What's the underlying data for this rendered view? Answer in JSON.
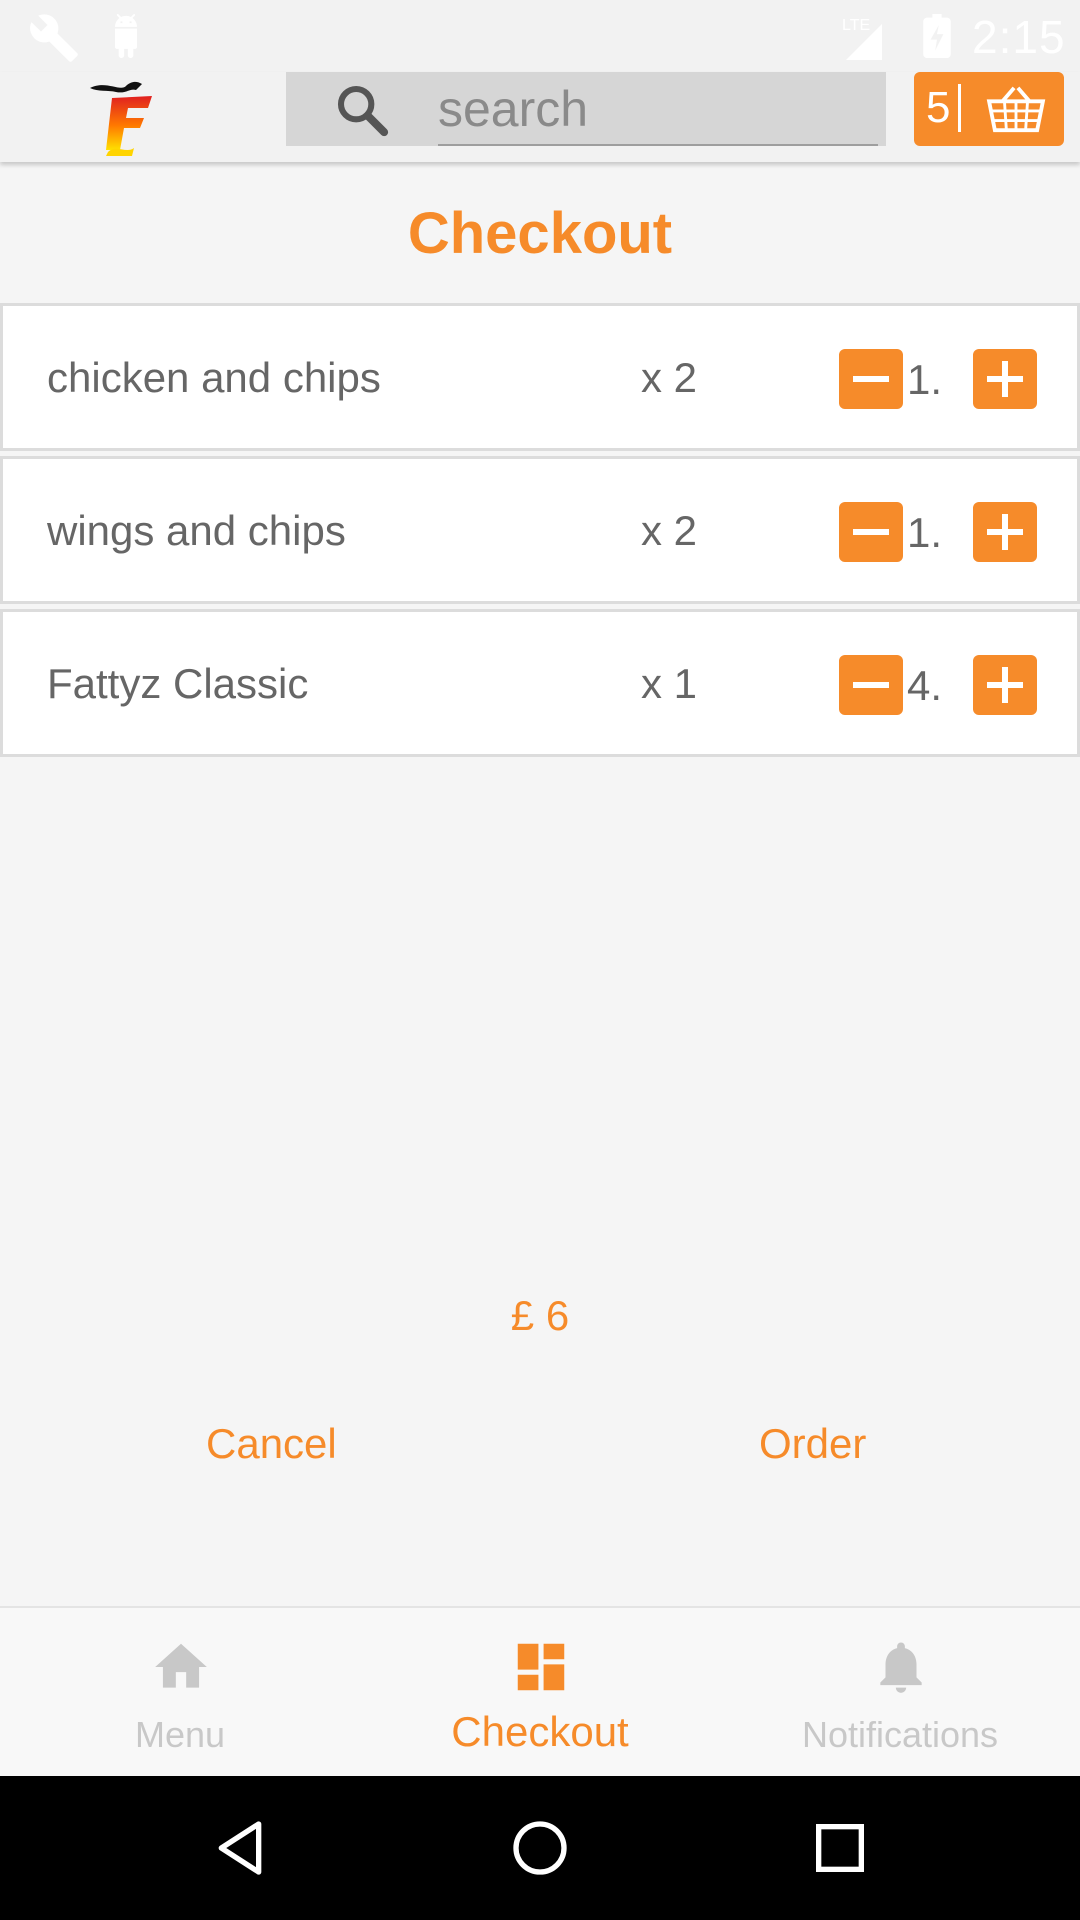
{
  "status_bar": {
    "time": "2:15",
    "icons": [
      "wrench-icon",
      "android-icon",
      "lte-signal-icon",
      "battery-charging-icon"
    ]
  },
  "toolbar": {
    "logo_icon": "fattyz-logo-icon",
    "search_placeholder": "search",
    "search_value": "",
    "search_icon": "search-icon",
    "cart_count": "5",
    "cart_icon": "basket-icon"
  },
  "page": {
    "title": "Checkout"
  },
  "cart_items": [
    {
      "name": "chicken and chips",
      "quantity": "x 2",
      "value": "1."
    },
    {
      "name": "wings and chips",
      "quantity": "x 2",
      "value": "1."
    },
    {
      "name": "Fattyz Classic",
      "quantity": "x 1",
      "value": "4."
    }
  ],
  "summary": {
    "total": "£ 6",
    "cancel_label": "Cancel",
    "order_label": "Order"
  },
  "bottom_nav": {
    "items": [
      {
        "label": "Menu",
        "icon": "home-icon",
        "active": false
      },
      {
        "label": "Checkout",
        "icon": "dashboard-icon",
        "active": true
      },
      {
        "label": "Notifications",
        "icon": "bell-icon",
        "active": false
      }
    ]
  },
  "colors": {
    "accent": "#f68b2a",
    "text_gray": "#666666",
    "inactive_nav": "#c8c8c8",
    "background": "#f5f5f5"
  }
}
